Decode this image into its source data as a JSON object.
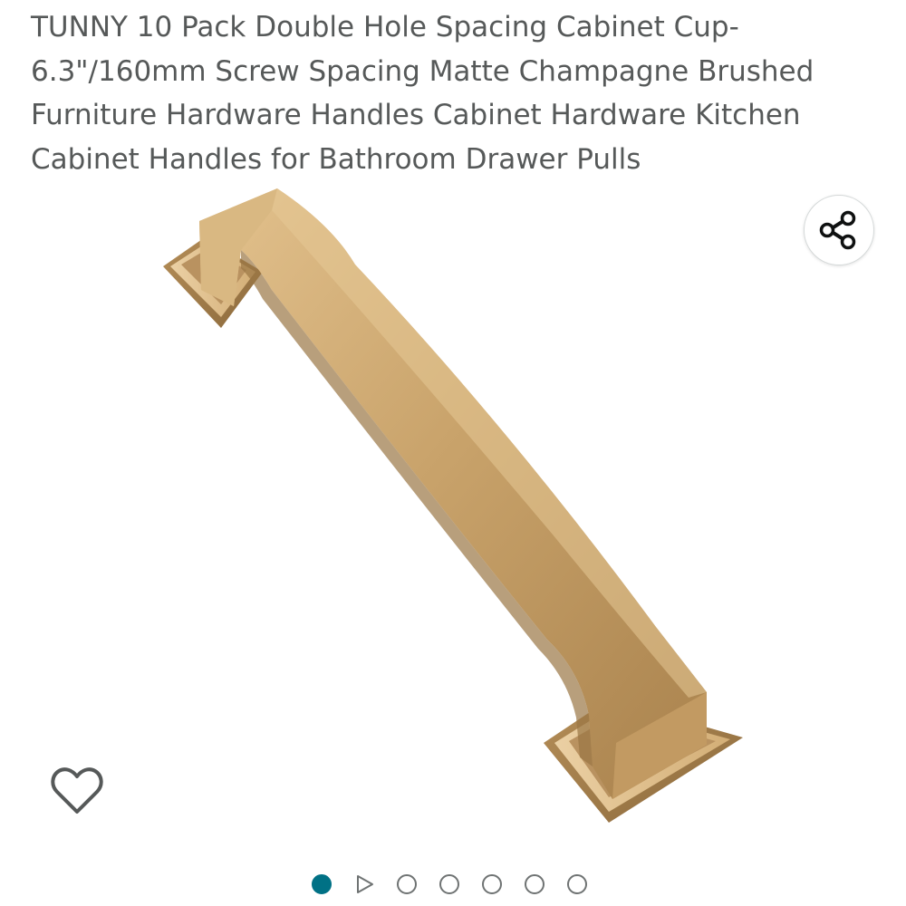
{
  "product": {
    "title": "TUNNY 10 Pack Double Hole Spacing Cabinet Cup-6.3\"/160mm Screw Spacing Matte Champagne Brushed Furniture Hardware Handles Cabinet Hardware Kitchen Cabinet Handles for Bathroom Drawer Pulls"
  },
  "icons": {
    "share": "share-icon",
    "wishlist": "heart-outline-icon",
    "video": "play-triangle-icon"
  },
  "carousel": {
    "total_items": 7,
    "active_index": 0,
    "video_index": 1
  },
  "colors": {
    "title_text": "#565959",
    "active_dot": "#007185",
    "inactive_dot": "#6f7373",
    "handle_gold": "#c9a36b"
  }
}
